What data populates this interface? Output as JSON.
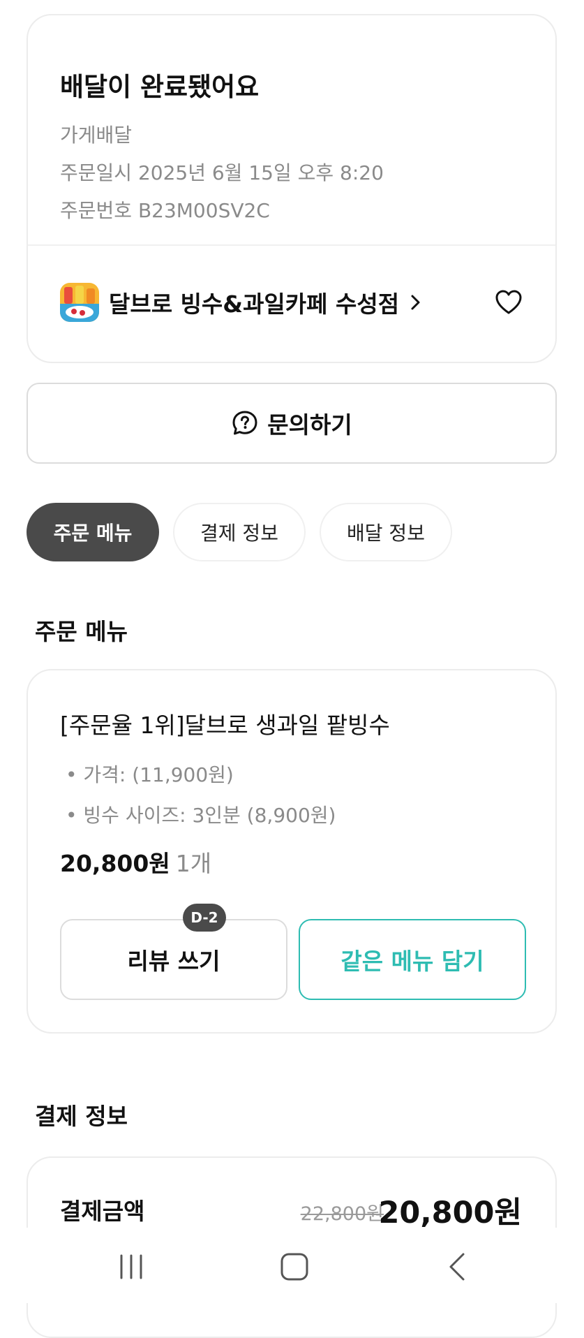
{
  "status": {
    "title": "배달이 완료됐어요",
    "delivery_type": "가게배달",
    "order_datetime": "주문일시 2025년 6월 15일 오후 8:20",
    "order_number": "주문번호 B23M00SV2C"
  },
  "store": {
    "name": "달브로 빙수&과일카페 수성점",
    "icons": {
      "chevron": "chevron-right-icon",
      "favorite": "heart-outline-icon"
    }
  },
  "inquiry": {
    "label": "문의하기",
    "icon": "question-chat-icon"
  },
  "tabs": [
    {
      "label": "주문 메뉴",
      "active": true
    },
    {
      "label": "결제 정보",
      "active": false
    },
    {
      "label": "배달 정보",
      "active": false
    }
  ],
  "order_menu": {
    "section_title": "주문 메뉴",
    "item": {
      "name": "[주문율 1위]달브로 생과일 팥빙수",
      "options": [
        "• 가격: (11,900원)",
        "• 빙수 사이즈: 3인분 (8,900원)"
      ],
      "price": "20,800원",
      "quantity": "1개"
    },
    "review_button": {
      "label": "리뷰 쓰기",
      "badge": "D-2"
    },
    "reorder_button": {
      "label": "같은 메뉴 담기"
    }
  },
  "payment": {
    "section_title": "결제 정보",
    "label": "결제금액",
    "original_price": "22,800원",
    "final_price": "20,800원"
  },
  "colors": {
    "accent": "#2ebcb2",
    "active_tab": "#4a4a4a",
    "muted_text": "#8a8a8a"
  },
  "system_nav": {
    "icons": [
      "recent-apps-icon",
      "home-icon",
      "back-icon"
    ]
  }
}
